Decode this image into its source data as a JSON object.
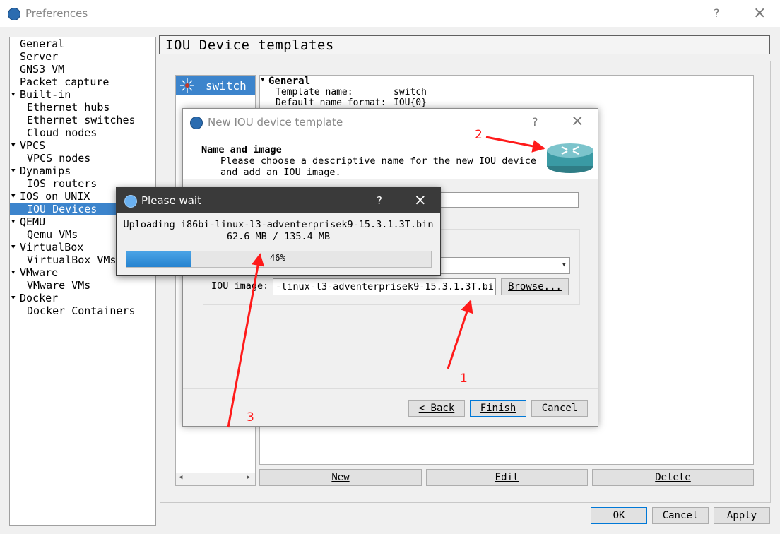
{
  "window": {
    "title": "Preferences",
    "help": "?",
    "close": "×"
  },
  "tree": [
    {
      "label": "General",
      "depth": 0
    },
    {
      "label": "Server",
      "depth": 0
    },
    {
      "label": "GNS3 VM",
      "depth": 0
    },
    {
      "label": "Packet capture",
      "depth": 0
    },
    {
      "label": "Built-in",
      "depth": 0,
      "expander": true
    },
    {
      "label": "Ethernet hubs",
      "depth": 1
    },
    {
      "label": "Ethernet switches",
      "depth": 1
    },
    {
      "label": "Cloud nodes",
      "depth": 1
    },
    {
      "label": "VPCS",
      "depth": 0,
      "expander": true
    },
    {
      "label": "VPCS nodes",
      "depth": 1
    },
    {
      "label": "Dynamips",
      "depth": 0,
      "expander": true
    },
    {
      "label": "IOS routers",
      "depth": 1
    },
    {
      "label": "IOS on UNIX",
      "depth": 0,
      "expander": true
    },
    {
      "label": "IOU Devices",
      "depth": 1,
      "selected": true
    },
    {
      "label": "QEMU",
      "depth": 0,
      "expander": true
    },
    {
      "label": "Qemu VMs",
      "depth": 1
    },
    {
      "label": "VirtualBox",
      "depth": 0,
      "expander": true
    },
    {
      "label": "VirtualBox VMs",
      "depth": 1
    },
    {
      "label": "VMware",
      "depth": 0,
      "expander": true
    },
    {
      "label": "VMware VMs",
      "depth": 1
    },
    {
      "label": "Docker",
      "depth": 0,
      "expander": true
    },
    {
      "label": "Docker Containers",
      "depth": 1
    }
  ],
  "page": {
    "title": "IOU Device templates"
  },
  "templates": [
    {
      "name": "switch"
    }
  ],
  "details": {
    "section": "General",
    "rows": [
      {
        "key": "Template name:",
        "value": "switch"
      },
      {
        "key": "Default name format:",
        "value": "IOU{0}"
      }
    ]
  },
  "list_buttons": {
    "new": "New",
    "edit": "Edit",
    "delete": "Delete"
  },
  "footer": {
    "ok": "OK",
    "cancel": "Cancel",
    "apply": "Apply"
  },
  "wizard": {
    "title": "New IOU device template",
    "help": "?",
    "close": "×",
    "heading": "Name and image",
    "description_line1": "Please choose a descriptive name for the new IOU device",
    "description_line2": "and add an IOU image.",
    "iou_image_label": "IOU image:",
    "iou_image_value": "-linux-l3-adventerprisek9-15.3.1.3T.bin",
    "browse": "Browse...",
    "back": "< Back",
    "finish": "Finish",
    "cancel": "Cancel"
  },
  "progress_dialog": {
    "title": "Please wait",
    "help": "?",
    "close": "×",
    "message": "Uploading i86bi-linux-l3-adventerprisek9-15.3.1.3T.bin",
    "size": "62.6 MB / 135.4 MB",
    "percent_label": "46%",
    "percent": 46
  },
  "annotations": {
    "one": "1",
    "two": "2",
    "three": "3"
  },
  "colors": {
    "accent": "#3c84cc",
    "arrow": "#ff1a1a",
    "progress": "#2683d0"
  },
  "icons": {
    "app": "gns3-logo-icon",
    "router": "router-icon",
    "template": "switch-icon"
  }
}
